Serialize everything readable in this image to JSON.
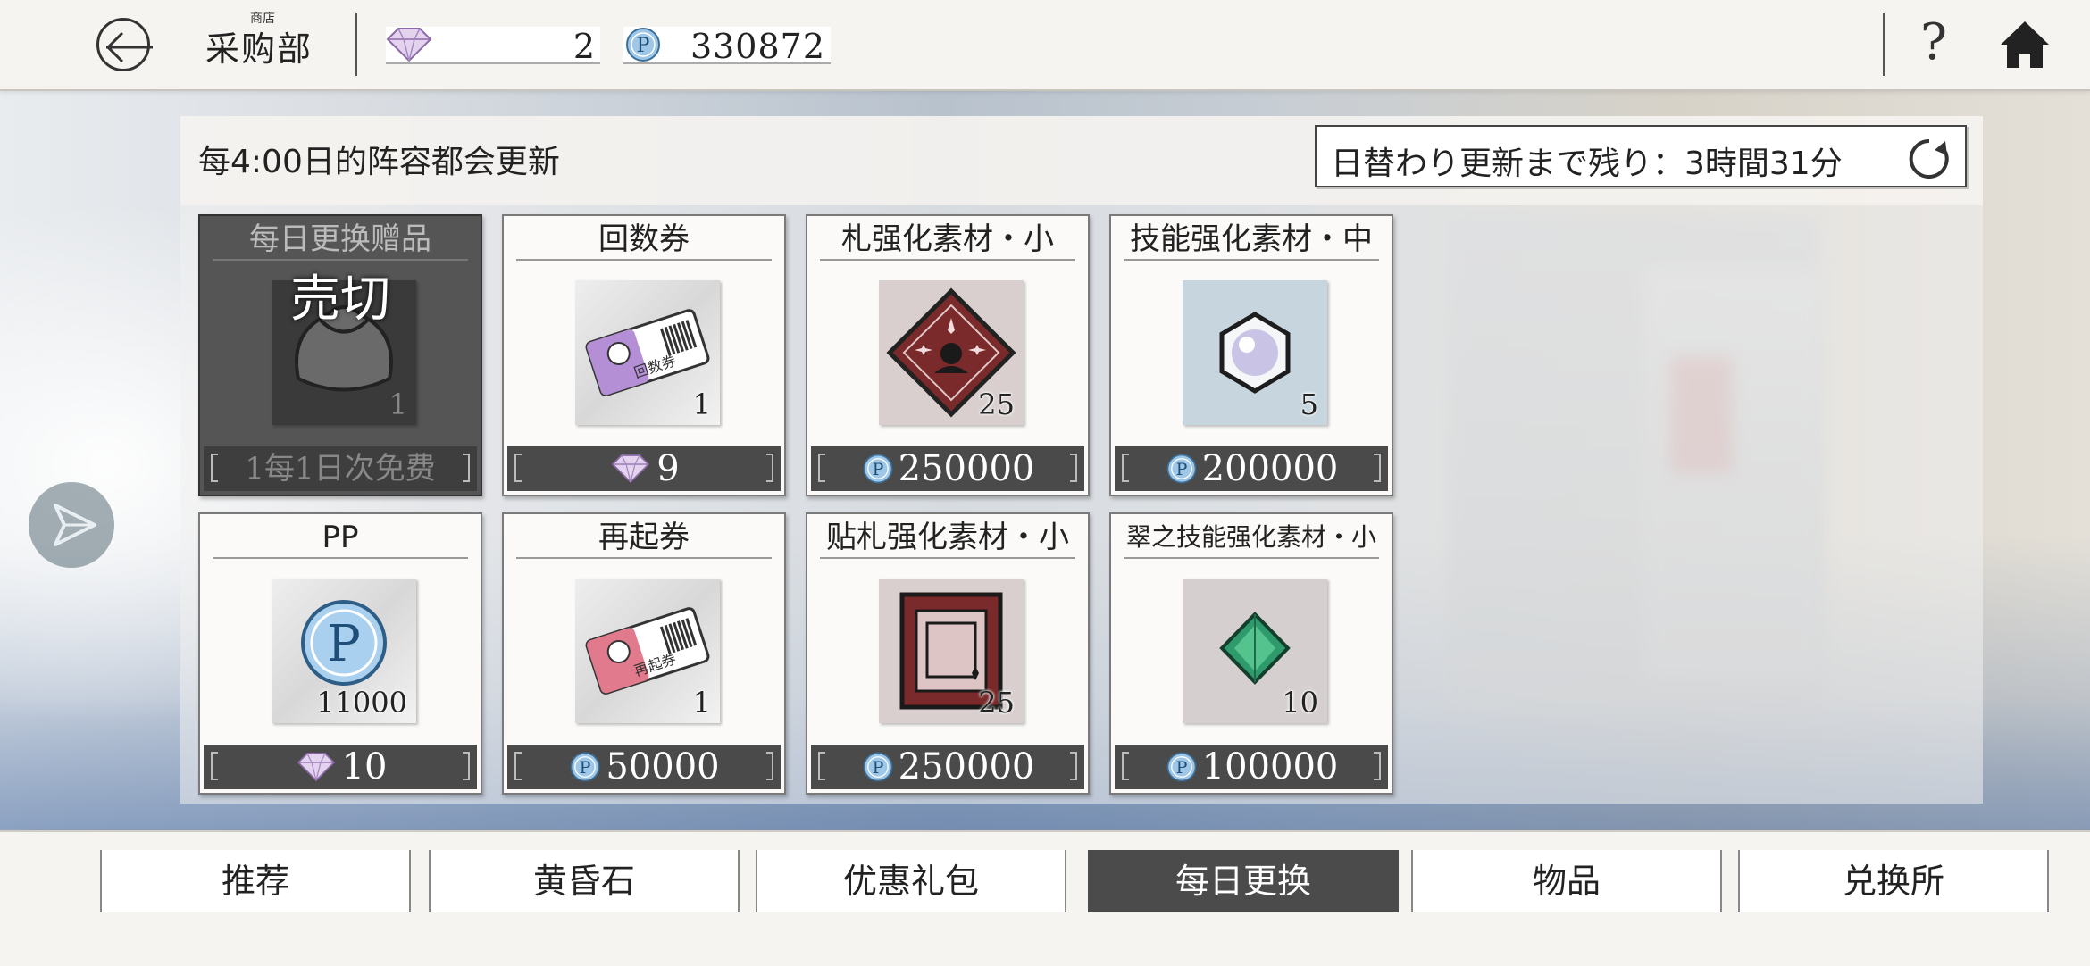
{
  "header": {
    "title_small": "商店",
    "title": "采购部",
    "gem_count": "2",
    "pcoin_count": "330872",
    "help_label": "?"
  },
  "shop": {
    "refresh_note": "每4:00日的阵容都会更新",
    "timer": "日替わり更新まで残り：3時間31分"
  },
  "items": [
    {
      "title": "每日更换赠品",
      "qty": "1",
      "price": "1每1日次免费",
      "currency": "none",
      "sold_out": true,
      "stamp": "売切",
      "icon": "gift-bag-icon"
    },
    {
      "title": "回数券",
      "qty": "1",
      "price": "9",
      "currency": "gem",
      "icon": "ticket-icon",
      "ticket_text": "回数券",
      "ticket_color": "#b58fd6"
    },
    {
      "title": "札强化素材・小",
      "qty": "25",
      "price": "250000",
      "currency": "pcoin",
      "icon": "card-enhance-diamond-icon"
    },
    {
      "title": "技能强化素材・中",
      "qty": "5",
      "price": "200000",
      "currency": "pcoin",
      "icon": "skill-hexagon-orb-icon"
    },
    {
      "title": "PP",
      "qty": "11000",
      "price": "10",
      "currency": "gem",
      "icon": "p-coin-icon"
    },
    {
      "title": "再起券",
      "qty": "1",
      "price": "50000",
      "currency": "pcoin",
      "icon": "ticket-icon",
      "ticket_text": "再起券",
      "ticket_color": "#e07a8c"
    },
    {
      "title": "贴札强化素材・小",
      "qty": "25",
      "price": "250000",
      "currency": "pcoin",
      "icon": "card-frame-enhance-icon"
    },
    {
      "title": "翠之技能强化素材・小",
      "qty": "10",
      "price": "100000",
      "currency": "pcoin",
      "icon": "emerald-gem-icon"
    }
  ],
  "tabs": [
    {
      "label": "推荐"
    },
    {
      "label": "黄昏石"
    },
    {
      "label": "优惠礼包"
    },
    {
      "label": "每日更换",
      "active": true
    },
    {
      "label": "物品"
    },
    {
      "label": "兑换所"
    }
  ],
  "colors": {
    "active_tab": "#4b4b4b",
    "price_bar": "#4a4a4a",
    "pcoin": "#5a9fd0",
    "gem": "#c9a8d8"
  }
}
